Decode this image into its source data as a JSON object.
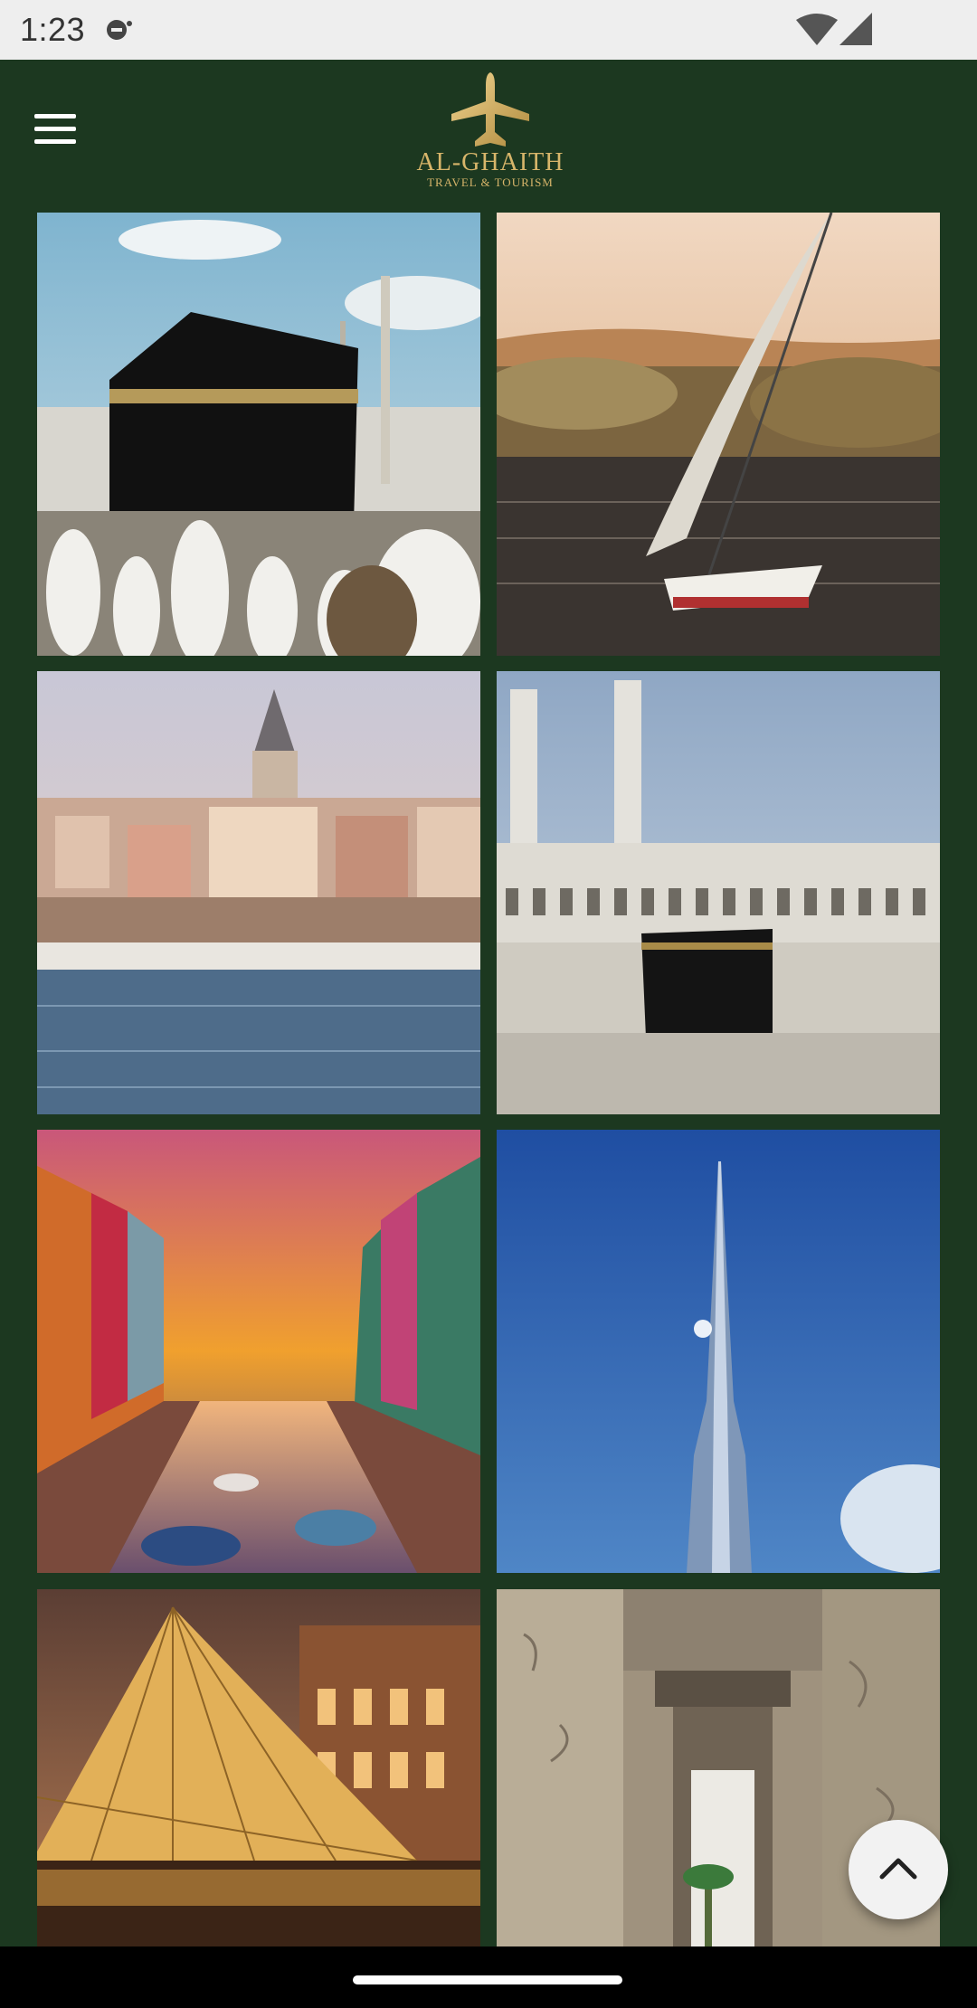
{
  "status_bar": {
    "time": "1:23"
  },
  "brand": {
    "name": "AL-GHAITH",
    "tagline": "TRAVEL & TOURISM",
    "accent": "#d7b56a",
    "background": "#1c3820"
  },
  "gallery": {
    "items": [
      {
        "icon": "kaaba-image"
      },
      {
        "icon": "felucca-nile-image"
      },
      {
        "icon": "istanbul-galata-image"
      },
      {
        "icon": "masjid-al-haram-image"
      },
      {
        "icon": "burano-canal-image"
      },
      {
        "icon": "burj-khalifa-image"
      },
      {
        "icon": "louvre-pyramid-image"
      },
      {
        "icon": "karnak-temple-image"
      }
    ]
  },
  "scroll_top": {
    "icon": "chevron-up-icon"
  }
}
